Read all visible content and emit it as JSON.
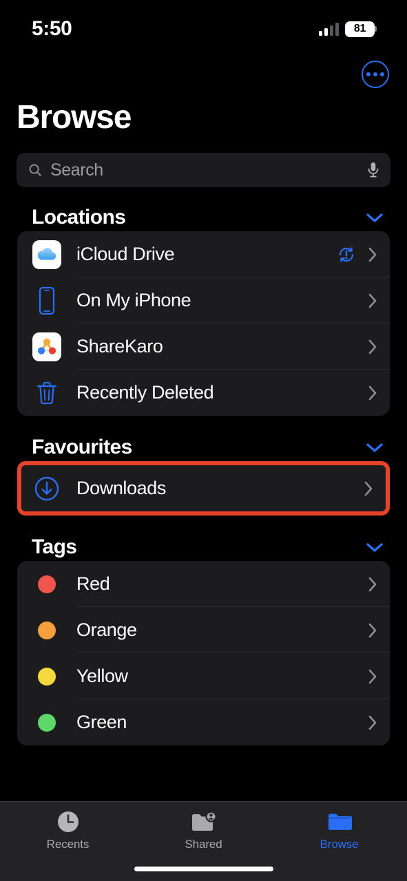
{
  "status_bar": {
    "time": "5:50",
    "battery_percent": "81",
    "cellular_icon": "cellular-signal-icon",
    "battery_icon": "battery-icon"
  },
  "nav": {
    "more_icon": "more-options-icon"
  },
  "header": {
    "title": "Browse"
  },
  "search": {
    "placeholder": "Search",
    "search_icon": "search-icon",
    "mic_icon": "microphone-icon"
  },
  "colors": {
    "accent_blue": "#2b6ef6",
    "highlight_red": "#e8432a",
    "card_background": "#1c1c1e",
    "page_background": "#000000",
    "tab_inactive": "#a8a8ad"
  },
  "sections": [
    {
      "title": "Locations",
      "collapse_icon": "chevron-down-icon",
      "items": [
        {
          "label": "iCloud Drive",
          "icon": "icloud-drive-icon",
          "badge": "sync-error-icon",
          "chevron": "chevron-right-icon"
        },
        {
          "label": "On My iPhone",
          "icon": "iphone-icon",
          "badge": null,
          "chevron": "chevron-right-icon"
        },
        {
          "label": "ShareKaro",
          "icon": "sharekaro-app-icon",
          "badge": null,
          "chevron": "chevron-right-icon"
        },
        {
          "label": "Recently Deleted",
          "icon": "trash-icon",
          "badge": null,
          "chevron": "chevron-right-icon"
        }
      ]
    },
    {
      "title": "Favourites",
      "collapse_icon": "chevron-down-icon",
      "items": [
        {
          "label": "Downloads",
          "icon": "download-circle-icon",
          "badge": null,
          "chevron": "chevron-right-icon",
          "highlighted": true
        }
      ]
    },
    {
      "title": "Tags",
      "collapse_icon": "chevron-down-icon",
      "items": [
        {
          "label": "Red",
          "icon": "tag-dot-icon",
          "dot_color": "#f0544a",
          "chevron": "chevron-right-icon"
        },
        {
          "label": "Orange",
          "icon": "tag-dot-icon",
          "dot_color": "#f5a03c",
          "chevron": "chevron-right-icon"
        },
        {
          "label": "Yellow",
          "icon": "tag-dot-icon",
          "dot_color": "#f5d83c",
          "chevron": "chevron-right-icon"
        },
        {
          "label": "Green",
          "icon": "tag-dot-icon",
          "dot_color": "#5ed66a",
          "chevron": "chevron-right-icon"
        }
      ]
    }
  ],
  "tab_bar": {
    "tabs": [
      {
        "label": "Recents",
        "icon": "clock-icon",
        "active": false
      },
      {
        "label": "Shared",
        "icon": "shared-folder-icon",
        "active": false
      },
      {
        "label": "Browse",
        "icon": "folder-icon",
        "active": true
      }
    ]
  }
}
